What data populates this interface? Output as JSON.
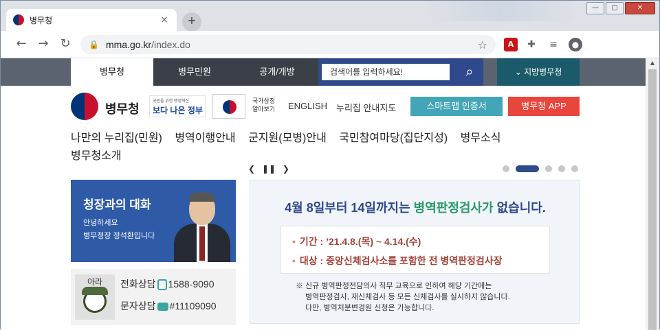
{
  "browser": {
    "tab_title": "병무청",
    "tab_close": "×",
    "new_tab": "+",
    "url_host": "mma.go.kr",
    "url_path": "/index.do",
    "win_min": "—",
    "win_max": "▢",
    "win_close": "✕"
  },
  "topnav": {
    "items": [
      "병무청",
      "병무민원",
      "공개/개방"
    ],
    "search_placeholder": "검색어를 입력하세요!",
    "regional_label": "지방병무청"
  },
  "header": {
    "logo_text": "병무청",
    "better_gov_small": "국민을 위한 행정혁신",
    "better_gov_main": "보다 나은 정부",
    "flag_label": "국가상징 알아보기",
    "links": [
      "ENGLISH",
      "누리집 안내지도"
    ],
    "smart_btn": "스마트맵 인증서",
    "app_btn": "병무청 APP"
  },
  "menu": {
    "items": [
      "나만의 누리집(민원)",
      "병역이행안내",
      "군지원(모병)안내",
      "국민참여마당(집단지성)",
      "병무소식",
      "병무청소개"
    ]
  },
  "slider": {
    "total": 5,
    "active_index": 1
  },
  "chief": {
    "title": "청장과의 대화",
    "line1": "안녕하세요",
    "line2": "병무청장 정석환입니다"
  },
  "ara": {
    "name": "아라",
    "phone_label": "전화상담",
    "phone": "1588-9090",
    "sms_label": "문자상담",
    "sms": "#11109090"
  },
  "notice": {
    "heading_pre": "4월 8일부터 14일까지는 ",
    "heading_hl": "병역판정검사가",
    "heading_post": " 없습니다.",
    "period": "기간 : ’21.4.8.(목) ~ 4.14.(수)",
    "target": "대상 : 중앙신체검사소를 포함한 전 병역판정검사장",
    "foot1": "※ 신규 병역판정전담의사 직무 교육으로 인하여 해당 기간에는",
    "foot2": "병역판정검사, 재신체검사 등 모든 신체검사를 실시하지 않습니다.",
    "foot3": "다만, 병역처분변경원 신청은 가능합니다."
  }
}
